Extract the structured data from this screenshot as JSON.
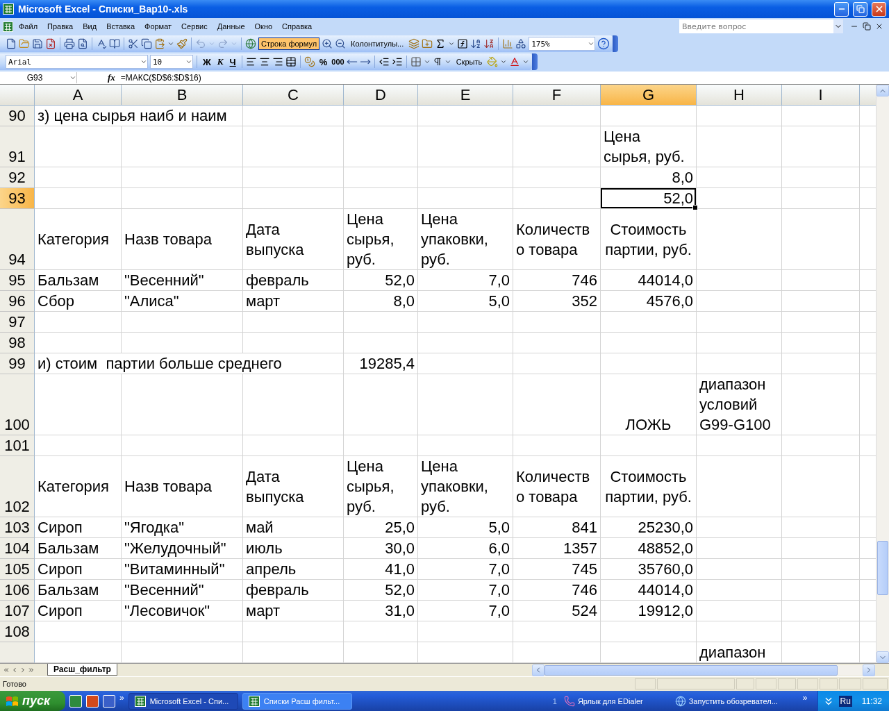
{
  "window": {
    "title": "Microsoft Excel - Списки_Вар10-.xls"
  },
  "menu": {
    "items": [
      "Файл",
      "Правка",
      "Вид",
      "Вставка",
      "Формат",
      "Сервис",
      "Данные",
      "Окно",
      "Справка"
    ],
    "help_placeholder": "Введите вопрос"
  },
  "standard_toolbar": {
    "formula_bar_button": {
      "label": "Строка формул",
      "pressed": true
    },
    "header_footer_button": "Колонтитулы...",
    "zoom": "175%"
  },
  "formatting_toolbar": {
    "font": "Arial",
    "size": "10",
    "bold": "Ж",
    "italic": "К",
    "underline": "Ч",
    "percent": "%",
    "thousands": "000",
    "hide_button": "Скрыть"
  },
  "formula_bar": {
    "name_box": "G93",
    "fx": "fx",
    "formula": "=МАКС($D$6:$D$16)"
  },
  "columns": [
    {
      "label": "A",
      "selected": false
    },
    {
      "label": "B",
      "selected": false
    },
    {
      "label": "C",
      "selected": false
    },
    {
      "label": "D",
      "selected": false
    },
    {
      "label": "E",
      "selected": false
    },
    {
      "label": "F",
      "selected": false
    },
    {
      "label": "G",
      "selected": true
    },
    {
      "label": "H",
      "selected": false
    },
    {
      "label": "I",
      "selected": false
    }
  ],
  "rows": [
    {
      "number": "90",
      "selected": false,
      "cells": [
        {
          "text": "з) цена сырья наиб и наим"
        }
      ]
    },
    {
      "number": "91",
      "selected": false,
      "cells": [
        null,
        null,
        null,
        null,
        null,
        null,
        {
          "text": "Цена\nсырья, руб."
        }
      ]
    },
    {
      "number": "92",
      "selected": false,
      "cells": [
        null,
        null,
        null,
        null,
        null,
        null,
        {
          "text": "8,0",
          "kind": "number"
        }
      ]
    },
    {
      "number": "93",
      "selected": true,
      "cells": [
        null,
        null,
        null,
        null,
        null,
        null,
        {
          "text": "52,0",
          "kind": "number"
        }
      ]
    },
    {
      "number": "94",
      "selected": false,
      "cells": [
        {
          "text": "Категория",
          "kind": "heading"
        },
        {
          "text": "Назв товара",
          "kind": "heading"
        },
        {
          "text": "Дата\nвыпуска",
          "kind": "heading"
        },
        {
          "text": "Цена\nсырья,\nруб.",
          "kind": "heading"
        },
        {
          "text": "Цена\nупаковки,\nруб.",
          "kind": "heading"
        },
        {
          "text": "Количеств\nо товара",
          "kind": "heading"
        },
        {
          "text": "Стоимость\nпартии, руб.",
          "kind": "title"
        }
      ]
    },
    {
      "number": "95",
      "selected": false,
      "cells": [
        {
          "text": "Бальзам"
        },
        {
          "text": "\"Весенний\""
        },
        {
          "text": "февраль"
        },
        {
          "text": "52,0",
          "kind": "number"
        },
        {
          "text": "7,0",
          "kind": "number"
        },
        {
          "text": "746",
          "kind": "number"
        },
        {
          "text": "44014,0",
          "kind": "number"
        }
      ]
    },
    {
      "number": "96",
      "selected": false,
      "cells": [
        {
          "text": "Сбор"
        },
        {
          "text": "\"Алиса\""
        },
        {
          "text": "март"
        },
        {
          "text": "8,0",
          "kind": "number"
        },
        {
          "text": "5,0",
          "kind": "number"
        },
        {
          "text": "352",
          "kind": "number"
        },
        {
          "text": "4576,0",
          "kind": "number"
        }
      ]
    },
    {
      "number": "97",
      "selected": false,
      "cells": []
    },
    {
      "number": "98",
      "selected": false,
      "cells": []
    },
    {
      "number": "99",
      "selected": false,
      "cells": [
        {
          "text": "и) стоим  партии больше среднего"
        },
        null,
        null,
        {
          "text": "19285,4",
          "kind": "number"
        }
      ]
    },
    {
      "number": "100",
      "selected": false,
      "cells": [
        null,
        null,
        null,
        null,
        null,
        null,
        {
          "text": "ЛОЖЬ",
          "kind": "logical"
        },
        {
          "text": "диапазон\nусловий\nG99-G100"
        }
      ]
    },
    {
      "number": "101",
      "selected": false,
      "cells": []
    },
    {
      "number": "102",
      "selected": false,
      "cells": [
        {
          "text": "Категория",
          "kind": "heading"
        },
        {
          "text": "Назв товара",
          "kind": "heading"
        },
        {
          "text": "Дата\nвыпуска",
          "kind": "heading"
        },
        {
          "text": "Цена\nсырья,\nруб.",
          "kind": "heading"
        },
        {
          "text": "Цена\nупаковки,\nруб.",
          "kind": "heading"
        },
        {
          "text": "Количеств\nо товара",
          "kind": "heading"
        },
        {
          "text": "Стоимость\nпартии, руб.",
          "kind": "title"
        }
      ]
    },
    {
      "number": "103",
      "selected": false,
      "cells": [
        {
          "text": "Сироп"
        },
        {
          "text": "\"Ягодка\""
        },
        {
          "text": "май"
        },
        {
          "text": "25,0",
          "kind": "number"
        },
        {
          "text": "5,0",
          "kind": "number"
        },
        {
          "text": "841",
          "kind": "number"
        },
        {
          "text": "25230,0",
          "kind": "number"
        }
      ]
    },
    {
      "number": "104",
      "selected": false,
      "cells": [
        {
          "text": "Бальзам"
        },
        {
          "text": "\"Желудочный\""
        },
        {
          "text": "июль"
        },
        {
          "text": "30,0",
          "kind": "number"
        },
        {
          "text": "6,0",
          "kind": "number"
        },
        {
          "text": "1357",
          "kind": "number"
        },
        {
          "text": "48852,0",
          "kind": "number"
        }
      ]
    },
    {
      "number": "105",
      "selected": false,
      "cells": [
        {
          "text": "Сироп"
        },
        {
          "text": "\"Витаминный\""
        },
        {
          "text": "апрель"
        },
        {
          "text": "41,0",
          "kind": "number"
        },
        {
          "text": "7,0",
          "kind": "number"
        },
        {
          "text": "745",
          "kind": "number"
        },
        {
          "text": "35760,0",
          "kind": "number"
        }
      ]
    },
    {
      "number": "106",
      "selected": false,
      "cells": [
        {
          "text": "Бальзам"
        },
        {
          "text": "\"Весенний\""
        },
        {
          "text": "февраль"
        },
        {
          "text": "52,0",
          "kind": "number"
        },
        {
          "text": "7,0",
          "kind": "number"
        },
        {
          "text": "746",
          "kind": "number"
        },
        {
          "text": "44014,0",
          "kind": "number"
        }
      ]
    },
    {
      "number": "107",
      "selected": false,
      "cells": [
        {
          "text": "Сироп"
        },
        {
          "text": "\"Лесовичок\""
        },
        {
          "text": "март"
        },
        {
          "text": "31,0",
          "kind": "number"
        },
        {
          "text": "7,0",
          "kind": "number"
        },
        {
          "text": "524",
          "kind": "number"
        },
        {
          "text": "19912,0",
          "kind": "number"
        }
      ]
    },
    {
      "number": "108",
      "selected": false,
      "cells": []
    },
    {
      "selected": false,
      "cells": [
        null,
        null,
        null,
        null,
        null,
        null,
        null,
        {
          "text": "диапазон",
          "kind": "continued"
        }
      ]
    }
  ],
  "sheet_tabs": [
    {
      "label": "Расш_фильтр",
      "selected": true
    }
  ],
  "status_bar": {
    "text": "Готово"
  },
  "taskbar": {
    "start": "пуск",
    "quick_launch_more": "»",
    "tasks": [
      {
        "label": "Microsoft Excel - Спи...",
        "selected": true
      },
      {
        "label": "Списки Расш фильт...",
        "selected": false
      }
    ],
    "count": "1",
    "items": [
      "Ярлык для EDialer",
      "Запустить обозревател..."
    ],
    "tray_more": "»",
    "language": "Ru",
    "clock": "11:32"
  }
}
